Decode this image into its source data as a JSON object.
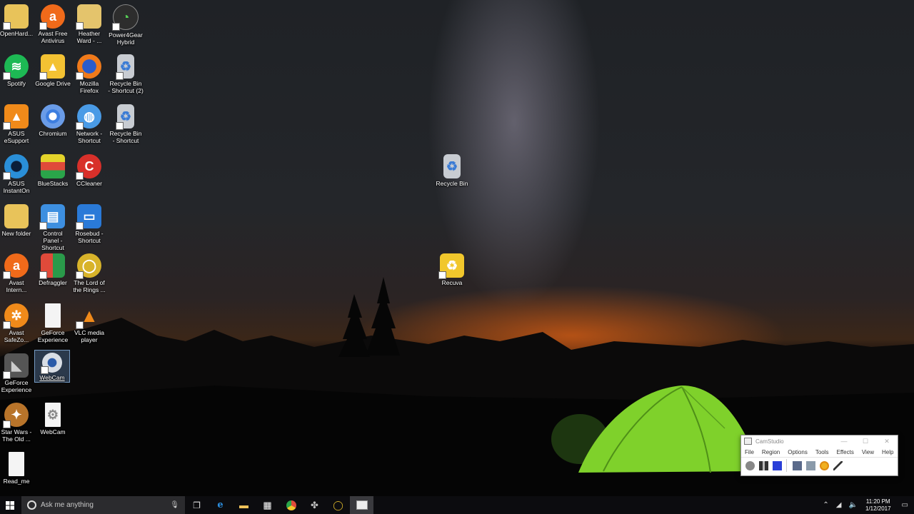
{
  "desktop": {
    "icons": [
      {
        "label": "OpenHard...",
        "icon": "folder-icon"
      },
      {
        "label": "Avast Free Antivirus",
        "icon": "avast-icon"
      },
      {
        "label": "Heather Ward - ...",
        "icon": "user-folder-icon"
      },
      {
        "label": "Power4Gear Hybrid",
        "icon": "power4gear-icon"
      },
      {
        "label": "Spotify",
        "icon": "spotify-icon"
      },
      {
        "label": "Google Drive",
        "icon": "google-drive-icon"
      },
      {
        "label": "Mozilla Firefox",
        "icon": "firefox-icon"
      },
      {
        "label": "Recycle Bin - Shortcut (2)",
        "icon": "recycle-bin-icon"
      },
      {
        "label": "ASUS eSupport",
        "icon": "asus-esupport-icon"
      },
      {
        "label": "Chromium",
        "icon": "chromium-icon"
      },
      {
        "label": "Network - Shortcut",
        "icon": "network-icon"
      },
      {
        "label": "Recycle Bin - Shortcut",
        "icon": "recycle-bin-icon"
      },
      {
        "label": "ASUS InstantOn",
        "icon": "asus-instanton-icon"
      },
      {
        "label": "BlueStacks",
        "icon": "bluestacks-icon"
      },
      {
        "label": "CCleaner",
        "icon": "ccleaner-icon"
      },
      {
        "label": "New folder",
        "icon": "folder-icon"
      },
      {
        "label": "Control Panel - Shortcut",
        "icon": "control-panel-icon"
      },
      {
        "label": "Rosebud - Shortcut",
        "icon": "computer-icon"
      },
      {
        "label": "Avast Intern...",
        "icon": "avast-icon"
      },
      {
        "label": "Defraggler",
        "icon": "defraggler-icon"
      },
      {
        "label": "The Lord of the Rings ...",
        "icon": "lotr-icon"
      },
      {
        "label": "Avast SafeZo...",
        "icon": "avast-safezone-icon"
      },
      {
        "label": "GeForce Experience",
        "icon": "document-icon"
      },
      {
        "label": "VLC media player",
        "icon": "vlc-icon"
      },
      {
        "label": "GeForce Experience",
        "icon": "geforce-icon"
      },
      {
        "label": "WebCam",
        "icon": "webcam-icon"
      },
      {
        "label": "Star Wars - The Old ...",
        "icon": "star-wars-icon"
      },
      {
        "label": "WebCam",
        "icon": "settings-file-icon"
      },
      {
        "label": "Read_me",
        "icon": "document-icon"
      },
      {
        "label": "Recycle Bin",
        "icon": "recycle-bin-icon"
      },
      {
        "label": "Recuva",
        "icon": "recuva-icon"
      }
    ]
  },
  "camstudio": {
    "title": "CamStudio",
    "menu": [
      "File",
      "Region",
      "Options",
      "Tools",
      "Effects",
      "View",
      "Help"
    ],
    "window_controls": [
      "—",
      "☐",
      "✕"
    ]
  },
  "taskbar": {
    "search_placeholder": "Ask me anything",
    "time": "11:20 PM",
    "date": "1/12/2017",
    "pinned": [
      "task-view-icon",
      "edge-icon",
      "file-explorer-icon",
      "store-icon",
      "chrome-icon",
      "app-icon",
      "lotr-icon",
      "camstudio-icon"
    ]
  },
  "colors": {
    "accent": "#1a73e8",
    "taskbar": "#0c0c0f",
    "tent_green": "#7fd12b"
  }
}
